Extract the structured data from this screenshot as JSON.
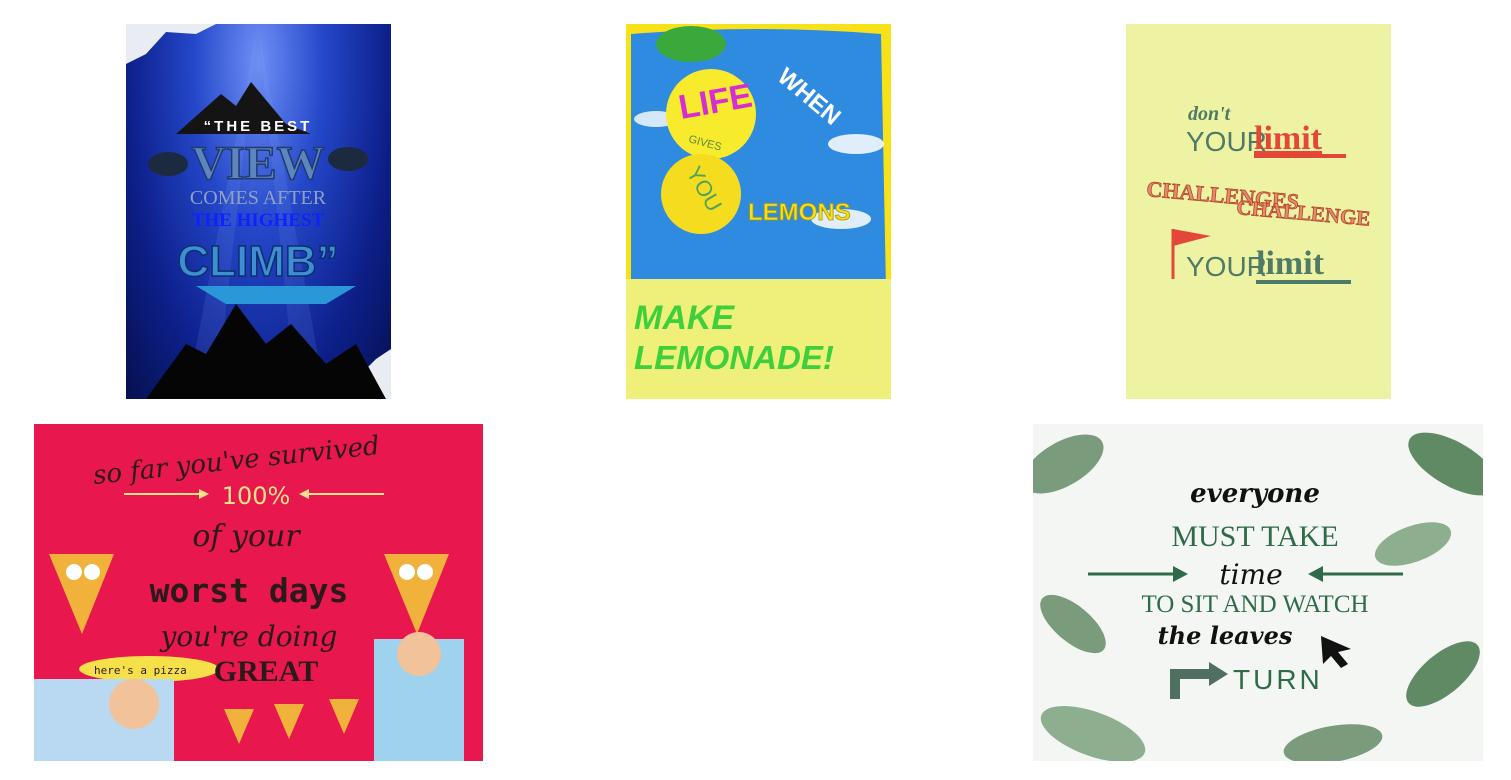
{
  "posters": [
    {
      "lines": [
        "“THE BEST",
        "VIEW",
        "COMES AFTER",
        "THE HIGHEST",
        "CLIMB”"
      ]
    },
    {
      "lines": [
        "WHEN",
        "LIFE",
        "GIVES",
        "YOU",
        "LEMONS",
        "MAKE",
        "LEMONADE!"
      ]
    },
    {
      "lines": [
        "don't",
        "YOUR",
        "limit",
        "CHALLENGES",
        "CHALLENGE",
        "YOUR",
        "limit"
      ]
    },
    {
      "lines": [
        "so far you've survived",
        "100%",
        "of your",
        "worst days",
        "you're doing",
        "here's a pizza",
        "GREAT"
      ]
    },
    {
      "lines": [
        "everyone",
        "MUST TAKE",
        "time",
        "TO SIT AND WATCH",
        "the leaves",
        "TURN"
      ]
    }
  ],
  "colors": {
    "mountain_blue": "#0d1f8a",
    "lemon_yellow": "#f7e21a",
    "limit_red": "#e4473a",
    "limit_green": "#4d7a63",
    "pizza_pink": "#e8174d",
    "leaf_green": "#2f6b48"
  }
}
